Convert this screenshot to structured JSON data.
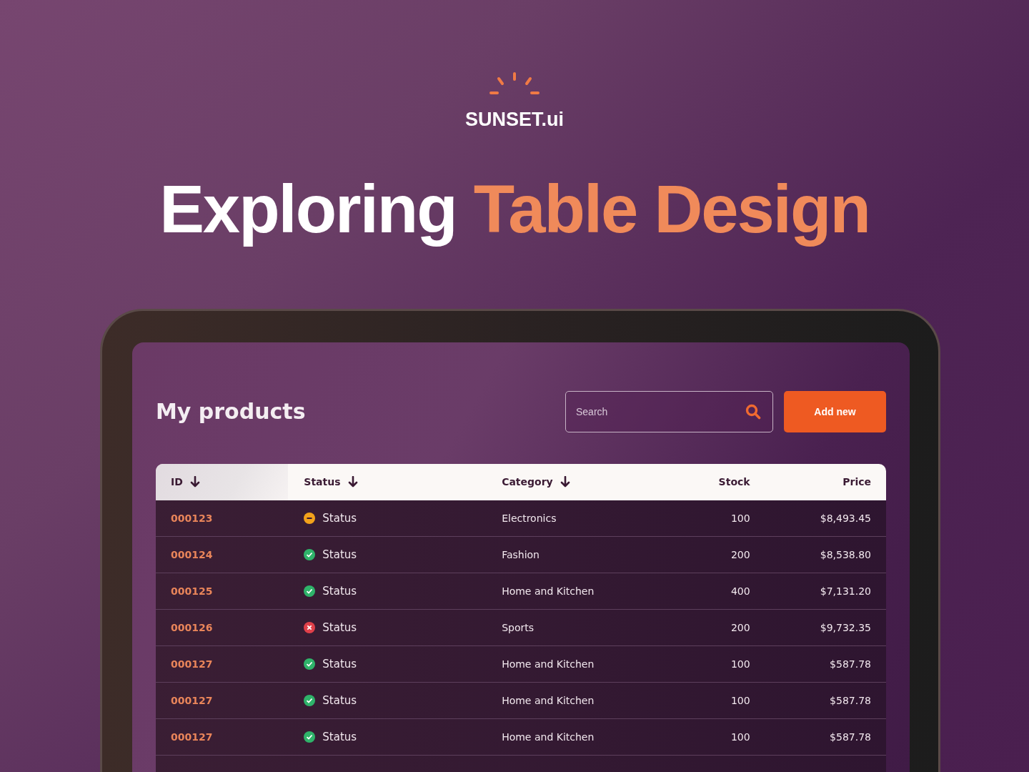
{
  "brand": {
    "name": "SUNSET.ui"
  },
  "headline": {
    "lead": "Exploring",
    "accent": "Table Design"
  },
  "page": {
    "title": "My products"
  },
  "search": {
    "placeholder": "Search"
  },
  "add_button": {
    "label": "Add new"
  },
  "table": {
    "columns": [
      {
        "label": "ID",
        "sortable": true
      },
      {
        "label": "Status",
        "sortable": true
      },
      {
        "label": "Category",
        "sortable": true
      },
      {
        "label": "Stock",
        "sortable": false
      },
      {
        "label": "Price",
        "sortable": false
      }
    ],
    "rows": [
      {
        "id": "000123",
        "status": {
          "kind": "pending",
          "label": "Status"
        },
        "category": "Electronics",
        "stock": "100",
        "price": "$8,493.45"
      },
      {
        "id": "000124",
        "status": {
          "kind": "ok",
          "label": "Status"
        },
        "category": "Fashion",
        "stock": "200",
        "price": "$8,538.80"
      },
      {
        "id": "000125",
        "status": {
          "kind": "ok",
          "label": "Status"
        },
        "category": "Home and Kitchen",
        "stock": "400",
        "price": "$7,131.20"
      },
      {
        "id": "000126",
        "status": {
          "kind": "error",
          "label": "Status"
        },
        "category": "Sports",
        "stock": "200",
        "price": "$9,732.35"
      },
      {
        "id": "000127",
        "status": {
          "kind": "ok",
          "label": "Status"
        },
        "category": "Home and Kitchen",
        "stock": "100",
        "price": "$587.78"
      },
      {
        "id": "000127",
        "status": {
          "kind": "ok",
          "label": "Status"
        },
        "category": "Home and Kitchen",
        "stock": "100",
        "price": "$587.78"
      },
      {
        "id": "000127",
        "status": {
          "kind": "ok",
          "label": "Status"
        },
        "category": "Home and Kitchen",
        "stock": "100",
        "price": "$587.78"
      }
    ]
  }
}
